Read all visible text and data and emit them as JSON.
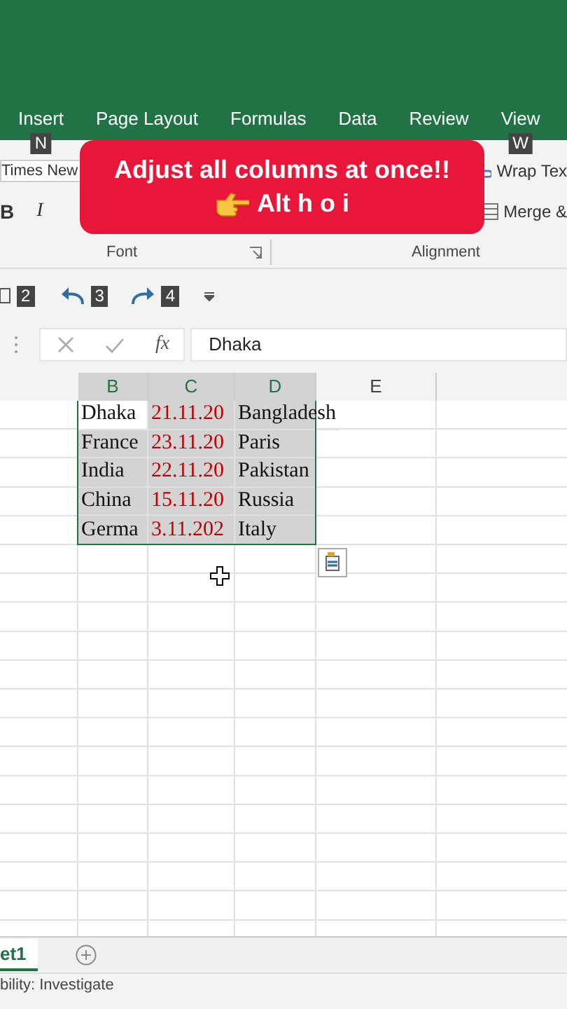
{
  "tabs": [
    {
      "label": "Insert",
      "key_tip": "N"
    },
    {
      "label": "Page Layout"
    },
    {
      "label": "Formulas"
    },
    {
      "label": "Data"
    },
    {
      "label": "Review"
    },
    {
      "label": "View",
      "key_tip": "W"
    }
  ],
  "ribbon": {
    "font_name": "Times New",
    "format_buttons": [
      "B",
      "I"
    ],
    "wrap_text": "Wrap Tex",
    "merge": "Merge &",
    "groups": [
      "Font",
      "Alignment"
    ]
  },
  "quick_access": {
    "key_tips": [
      "2",
      "3",
      "4"
    ]
  },
  "formula_bar": {
    "fx": "fx",
    "value": "Dhaka"
  },
  "columns": [
    {
      "label": "B",
      "selected": true
    },
    {
      "label": "C",
      "selected": true
    },
    {
      "label": "D",
      "selected": true
    },
    {
      "label": "E",
      "selected": false
    }
  ],
  "rows": [
    {
      "cells": [
        {
          "text": "Dhaka",
          "kind": "text",
          "selected": false
        },
        {
          "text": "21.11.20",
          "kind": "date",
          "selected": true
        },
        {
          "text": "Bangladesh",
          "kind": "text",
          "selected": true
        }
      ]
    },
    {
      "cells": [
        {
          "text": "France",
          "kind": "text",
          "selected": true
        },
        {
          "text": "23.11.20",
          "kind": "date",
          "selected": true
        },
        {
          "text": "Paris",
          "kind": "text",
          "selected": true
        }
      ]
    },
    {
      "cells": [
        {
          "text": "India",
          "kind": "text",
          "selected": true
        },
        {
          "text": "22.11.20",
          "kind": "date",
          "selected": true
        },
        {
          "text": "Pakistan",
          "kind": "text",
          "selected": true
        }
      ]
    },
    {
      "cells": [
        {
          "text": "China",
          "kind": "text",
          "selected": true
        },
        {
          "text": "15.11.20",
          "kind": "date",
          "selected": true
        },
        {
          "text": "Russia",
          "kind": "text",
          "selected": true
        }
      ]
    },
    {
      "cells": [
        {
          "text": "Germa",
          "kind": "text",
          "selected": true
        },
        {
          "text": "3.11.202",
          "kind": "date",
          "selected": true
        },
        {
          "text": "Italy",
          "kind": "text",
          "selected": true
        }
      ]
    }
  ],
  "sheet_tab": {
    "label": "et1",
    "selected": true
  },
  "status_bar": "bility: Investigate",
  "banner": {
    "title": "Adjust all columns at once!!",
    "shortcut": "Alt h o i"
  }
}
